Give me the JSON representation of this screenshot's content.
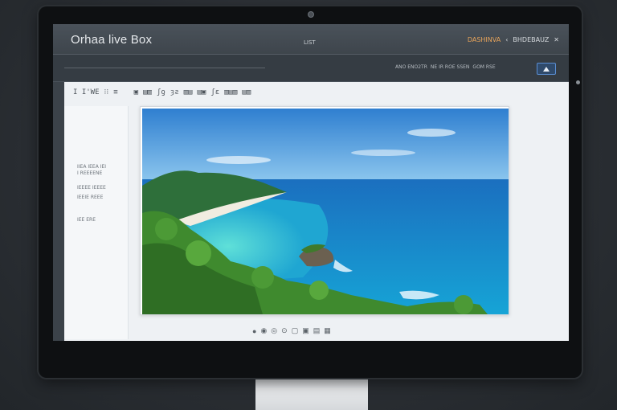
{
  "window": {
    "app_title": "Orhaa live Box",
    "center_label": "LIST",
    "right_labels": [
      "DASHINVA",
      "‹",
      "BHDEBAUZ",
      "✕"
    ]
  },
  "subbar": {
    "right_text": [
      "ANO ENO2TR",
      "NE IR ROE SSEN",
      "GOM RSE"
    ]
  },
  "toolbar": {
    "items": [
      "I I'WE",
      "⁝⁝",
      "≡",
      "▣",
      "▤▥",
      "ʃƍ",
      "ȝƨ",
      "▥▤",
      "▤▣",
      "ʃɛ",
      "▥▤▥",
      "▤▥"
    ]
  },
  "sidebar": {
    "items": [
      "IIEA IEEA IEI",
      "I REEEENE",
      "IEEEE IEEEE",
      "IEEIE REEE",
      "IEE ERE"
    ]
  },
  "viewer": {
    "image_label": "beach-landscape"
  },
  "bottom_controls": [
    "●",
    "◉",
    "◎",
    "⊙",
    "▢",
    "▣",
    "▤",
    "▦"
  ],
  "colors": {
    "sky_top": "#2f7fd0",
    "sea": "#16a4d6",
    "lagoon": "#3fd1d6",
    "foliage": "#3f8a2e",
    "accent": "#5a8fd4"
  }
}
